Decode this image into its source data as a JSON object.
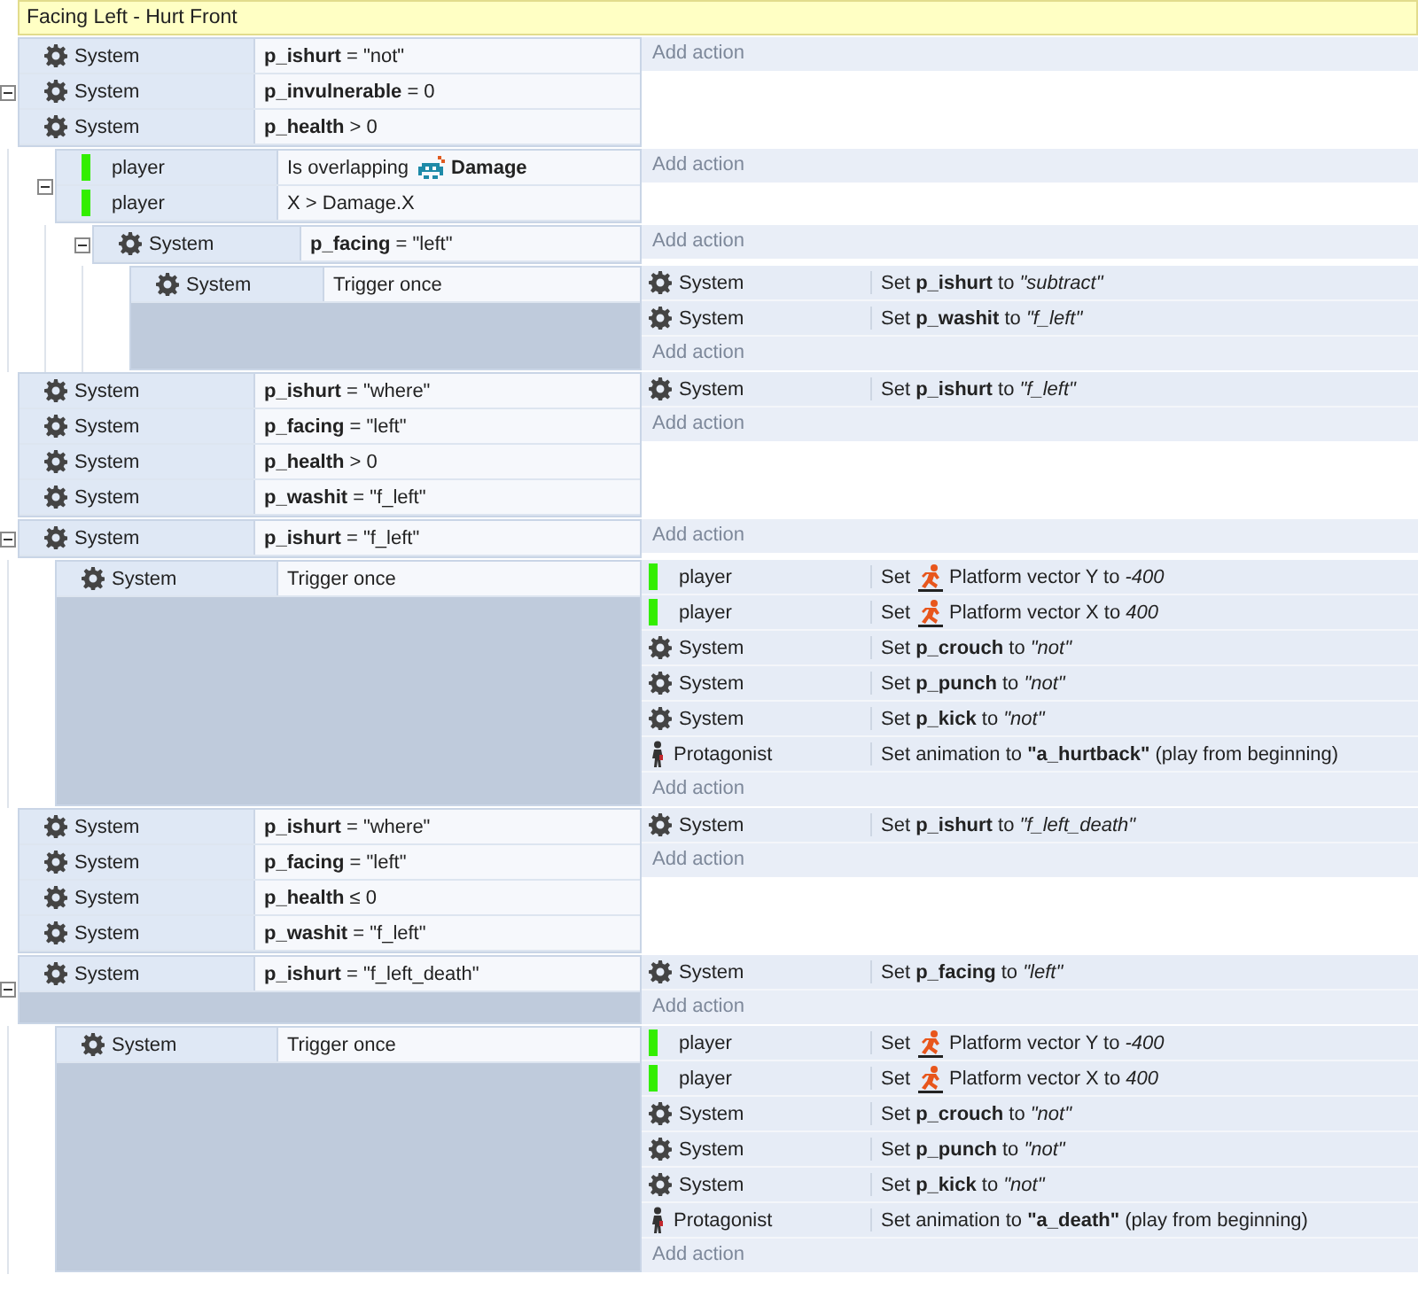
{
  "group": {
    "title": "Facing Left - Hurt Front"
  },
  "events": [
    {
      "expanded": true,
      "conditions": [
        {
          "kind": "system",
          "object": "System",
          "parts": [
            {
              "kind": "text",
              "text": "**p_ishurt** = \"not\""
            }
          ]
        },
        {
          "kind": "system",
          "object": "System",
          "parts": [
            {
              "kind": "text",
              "text": "**p_invulnerable** = 0"
            }
          ]
        },
        {
          "kind": "system",
          "object": "System",
          "parts": [
            {
              "kind": "text",
              "text": "**p_health** > 0"
            }
          ]
        }
      ],
      "add_action": "Add action",
      "children": [
        {
          "expanded": true,
          "conditions": [
            {
              "kind": "sprite",
              "object": "player",
              "parts": [
                {
                  "kind": "text",
                  "text": "Is overlapping"
                },
                {
                  "kind": "object",
                  "text": "**Damage**"
                }
              ]
            },
            {
              "kind": "sprite",
              "object": "player",
              "parts": [
                {
                  "kind": "text",
                  "text": "X > Damage.X"
                }
              ]
            }
          ],
          "add_action": "Add action",
          "children": [
            {
              "expanded": true,
              "conditions": [
                {
                  "kind": "system",
                  "object": "System",
                  "parts": [
                    {
                      "kind": "text",
                      "text": "**p_facing** = \"left\""
                    }
                  ]
                }
              ],
              "add_action": "Add action",
              "children": [
                {
                  "conditions": [
                    {
                      "kind": "system",
                      "object": "System",
                      "parts": [
                        {
                          "kind": "text",
                          "text": "Trigger once"
                        }
                      ]
                    }
                  ],
                  "actions": [
                    {
                      "kind": "system",
                      "object": "System",
                      "parts": [
                        {
                          "kind": "text",
                          "text": "Set **p_ishurt** to *\"subtract\"*"
                        }
                      ]
                    },
                    {
                      "kind": "system",
                      "object": "System",
                      "parts": [
                        {
                          "kind": "text",
                          "text": "Set **p_washit** to *\"f_left\"*"
                        }
                      ]
                    }
                  ],
                  "add_action": "Add action"
                }
              ]
            }
          ]
        }
      ]
    },
    {
      "conditions": [
        {
          "kind": "system",
          "object": "System",
          "parts": [
            {
              "kind": "text",
              "text": "**p_ishurt** = \"where\""
            }
          ]
        },
        {
          "kind": "system",
          "object": "System",
          "parts": [
            {
              "kind": "text",
              "text": "**p_facing** = \"left\""
            }
          ]
        },
        {
          "kind": "system",
          "object": "System",
          "parts": [
            {
              "kind": "text",
              "text": "**p_health** > 0"
            }
          ]
        },
        {
          "kind": "system",
          "object": "System",
          "parts": [
            {
              "kind": "text",
              "text": "**p_washit** = \"f_left\""
            }
          ]
        }
      ],
      "actions": [
        {
          "kind": "system",
          "object": "System",
          "parts": [
            {
              "kind": "text",
              "text": "Set **p_ishurt** to *\"f_left\"*"
            }
          ]
        }
      ],
      "add_action": "Add action"
    },
    {
      "expanded": true,
      "conditions": [
        {
          "kind": "system",
          "object": "System",
          "parts": [
            {
              "kind": "text",
              "text": "**p_ishurt** = \"f_left\""
            }
          ]
        }
      ],
      "add_action": "Add action",
      "children": [
        {
          "conditions": [
            {
              "kind": "system",
              "object": "System",
              "parts": [
                {
                  "kind": "text",
                  "text": "Trigger once"
                }
              ]
            }
          ],
          "actions": [
            {
              "kind": "sprite",
              "object": "player",
              "parts": [
                {
                  "kind": "text",
                  "text": "Set"
                },
                {
                  "kind": "behavior",
                  "text": "Platform vector Y to *-400*"
                }
              ]
            },
            {
              "kind": "sprite",
              "object": "player",
              "parts": [
                {
                  "kind": "text",
                  "text": "Set"
                },
                {
                  "kind": "behavior",
                  "text": "Platform vector X to *400*"
                }
              ]
            },
            {
              "kind": "system",
              "object": "System",
              "parts": [
                {
                  "kind": "text",
                  "text": "Set **p_crouch** to *\"not\"*"
                }
              ]
            },
            {
              "kind": "system",
              "object": "System",
              "parts": [
                {
                  "kind": "text",
                  "text": "Set **p_punch** to *\"not\"*"
                }
              ]
            },
            {
              "kind": "system",
              "object": "System",
              "parts": [
                {
                  "kind": "text",
                  "text": "Set **p_kick** to *\"not\"*"
                }
              ]
            },
            {
              "kind": "character",
              "object": "Protagonist",
              "parts": [
                {
                  "kind": "text",
                  "text": "Set animation to **\"a_hurtback\"** (play from beginning)"
                }
              ]
            }
          ],
          "add_action": "Add action"
        }
      ]
    },
    {
      "conditions": [
        {
          "kind": "system",
          "object": "System",
          "parts": [
            {
              "kind": "text",
              "text": "**p_ishurt** = \"where\""
            }
          ]
        },
        {
          "kind": "system",
          "object": "System",
          "parts": [
            {
              "kind": "text",
              "text": "**p_facing** = \"left\""
            }
          ]
        },
        {
          "kind": "system",
          "object": "System",
          "parts": [
            {
              "kind": "text",
              "text": "**p_health** ≤ 0"
            }
          ]
        },
        {
          "kind": "system",
          "object": "System",
          "parts": [
            {
              "kind": "text",
              "text": "**p_washit** = \"f_left\""
            }
          ]
        }
      ],
      "actions": [
        {
          "kind": "system",
          "object": "System",
          "parts": [
            {
              "kind": "text",
              "text": "Set **p_ishurt** to *\"f_left_death\"*"
            }
          ]
        }
      ],
      "add_action": "Add action"
    },
    {
      "expanded": true,
      "conditions": [
        {
          "kind": "system",
          "object": "System",
          "parts": [
            {
              "kind": "text",
              "text": "**p_ishurt** = \"f_left_death\""
            }
          ]
        }
      ],
      "actions": [
        {
          "kind": "system",
          "object": "System",
          "parts": [
            {
              "kind": "text",
              "text": "Set **p_facing** to *\"left\"*"
            }
          ]
        }
      ],
      "add_action": "Add action",
      "children": [
        {
          "conditions": [
            {
              "kind": "system",
              "object": "System",
              "parts": [
                {
                  "kind": "text",
                  "text": "Trigger once"
                }
              ]
            }
          ],
          "actions": [
            {
              "kind": "sprite",
              "object": "player",
              "parts": [
                {
                  "kind": "text",
                  "text": "Set"
                },
                {
                  "kind": "behavior",
                  "text": "Platform vector Y to *-400*"
                }
              ]
            },
            {
              "kind": "sprite",
              "object": "player",
              "parts": [
                {
                  "kind": "text",
                  "text": "Set"
                },
                {
                  "kind": "behavior",
                  "text": "Platform vector X to *400*"
                }
              ]
            },
            {
              "kind": "system",
              "object": "System",
              "parts": [
                {
                  "kind": "text",
                  "text": "Set **p_crouch** to *\"not\"*"
                }
              ]
            },
            {
              "kind": "system",
              "object": "System",
              "parts": [
                {
                  "kind": "text",
                  "text": "Set **p_punch** to *\"not\"*"
                }
              ]
            },
            {
              "kind": "system",
              "object": "System",
              "parts": [
                {
                  "kind": "text",
                  "text": "Set **p_kick** to *\"not\"*"
                }
              ]
            },
            {
              "kind": "character",
              "object": "Protagonist",
              "parts": [
                {
                  "kind": "text",
                  "text": "Set animation to **\"a_death\"** (play from beginning)"
                }
              ]
            }
          ],
          "add_action": "Add action"
        }
      ]
    }
  ]
}
